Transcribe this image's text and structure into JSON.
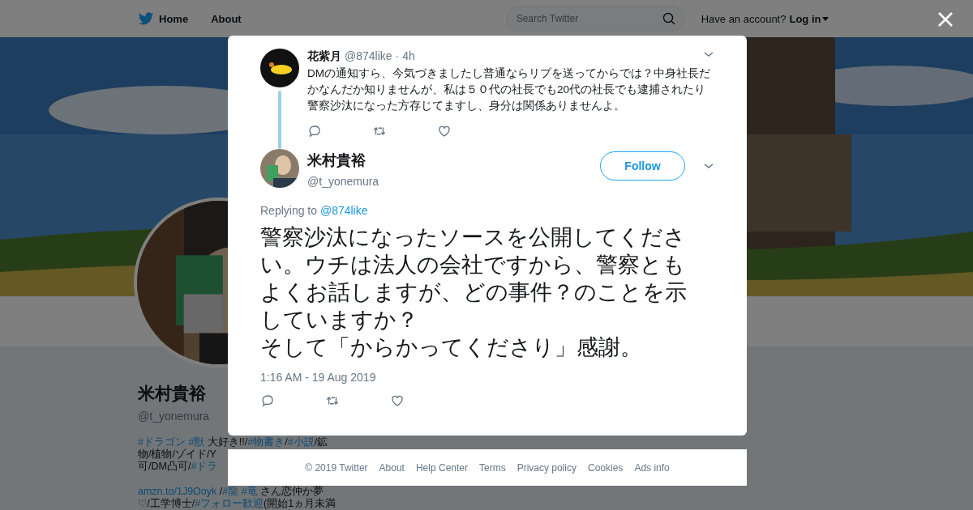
{
  "header": {
    "nav": [
      {
        "label": "Home",
        "selected": false
      },
      {
        "label": "About",
        "selected": false
      }
    ],
    "search": {
      "placeholder": "Search Twitter"
    },
    "account_prompt": "Have an account?",
    "login": "Log in"
  },
  "profile": {
    "name": "米村貴裕",
    "handle": "@t_yonemura",
    "bio_lines": [
      {
        "parts": [
          {
            "text": "#ドラゴン ",
            "kind": "link"
          },
          {
            "text": "#獣",
            "kind": "link"
          },
          {
            "text": " 大好き!!/",
            "kind": "plain"
          },
          {
            "text": "#物書き",
            "kind": "link"
          },
          {
            "text": "/",
            "kind": "plain"
          },
          {
            "text": "#小説",
            "kind": "link"
          },
          {
            "text": "/鉱",
            "kind": "plain"
          }
        ]
      },
      {
        "parts": [
          {
            "text": "物/植物/ゾイド/Y",
            "kind": "plain"
          }
        ]
      },
      {
        "parts": [
          {
            "text": "可/DM凸可/",
            "kind": "plain"
          },
          {
            "text": "#ドラ",
            "kind": "link"
          }
        ]
      },
      {
        "parts": [
          {
            "text": "amzn.to/1J9Ooyk",
            "kind": "link"
          },
          {
            "text": " /",
            "kind": "plain"
          },
          {
            "text": "#龍 ",
            "kind": "link"
          },
          {
            "text": "#竜",
            "kind": "link"
          },
          {
            "text": " さん恋仲か夢",
            "kind": "plain"
          }
        ]
      },
      {
        "parts": [
          {
            "text": "♡/工学博士/",
            "kind": "plain"
          },
          {
            "text": "#フォロー歓迎",
            "kind": "link"
          },
          {
            "text": "(開始1ヵ月未満",
            "kind": "plain"
          }
        ]
      }
    ]
  },
  "modal": {
    "parent_tweet": {
      "name": "花紫月",
      "handle": "@874like",
      "time": "· 4h",
      "text": "DMの通知すら、今気づきましたし普通ならリプを送ってからでは？中身社長だかなんだか知りませんが、私は５０代の社長でも20代の社長でも逮捕されたり警察沙汰になった方存じてますし、身分は関係ありませんよ。"
    },
    "tweet": {
      "name": "米村貴裕",
      "handle": "@t_yonemura",
      "follow": "Follow",
      "replying_label": "Replying to",
      "replying_to": "@874like",
      "text_lines": [
        "警察沙汰になったソースを公開してください。ウチは法人の会社ですから、警察ともよくお話しますが、どの事件？のことを示していますか？",
        "そして「からかってくださり」感謝。"
      ],
      "timestamp": "1:16 AM - 19 Aug 2019"
    }
  },
  "footer": [
    "© 2019 Twitter",
    "About",
    "Help Center",
    "Terms",
    "Privacy policy",
    "Cookies",
    "Ads info"
  ]
}
